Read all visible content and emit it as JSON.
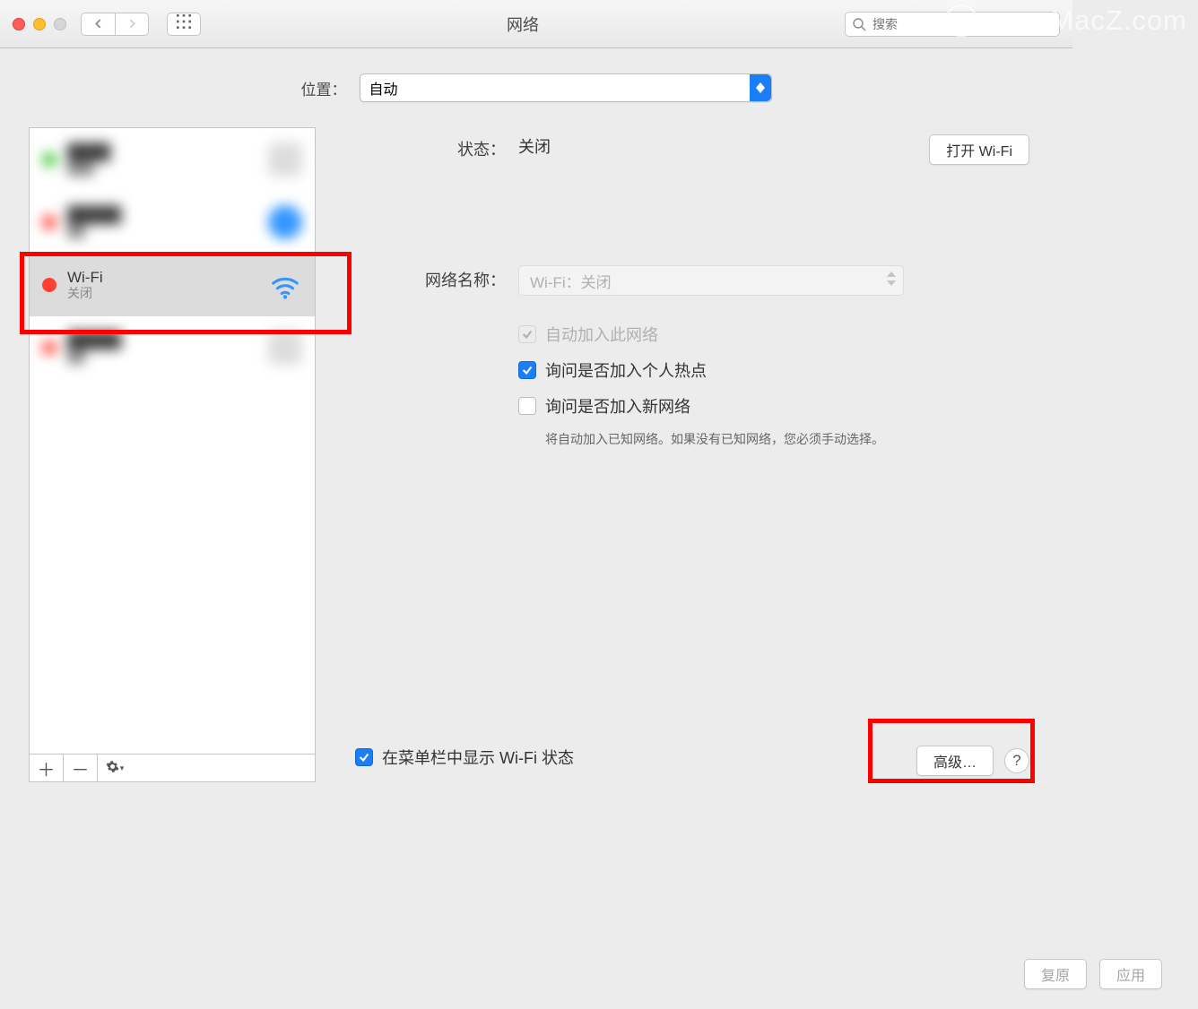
{
  "title": "网络",
  "watermark": "www.MacZ.com",
  "search": {
    "placeholder": "搜索"
  },
  "location": {
    "label": "位置：",
    "value": "自动"
  },
  "sidebar": {
    "items": [
      {
        "name": "",
        "sub": "",
        "status": "green"
      },
      {
        "name": "",
        "sub": "",
        "status": "red"
      },
      {
        "name": "Wi-Fi",
        "sub": "关闭",
        "status": "red"
      },
      {
        "name": "",
        "sub": "",
        "status": "red"
      }
    ]
  },
  "details": {
    "status_label": "状态：",
    "status_value": "关闭",
    "wifi_button": "打开 Wi-Fi",
    "network_name_label": "网络名称：",
    "network_name_value": "Wi-Fi：关闭",
    "auto_join": "自动加入此网络",
    "ask_hotspot": "询问是否加入个人热点",
    "ask_new": "询问是否加入新网络",
    "ask_new_hint": "将自动加入已知网络。如果没有已知网络，您必须手动选择。",
    "menubar": "在菜单栏中显示 Wi-Fi 状态",
    "advanced_button": "高级…",
    "help": "?"
  },
  "buttons": {
    "revert": "复原",
    "apply": "应用"
  }
}
